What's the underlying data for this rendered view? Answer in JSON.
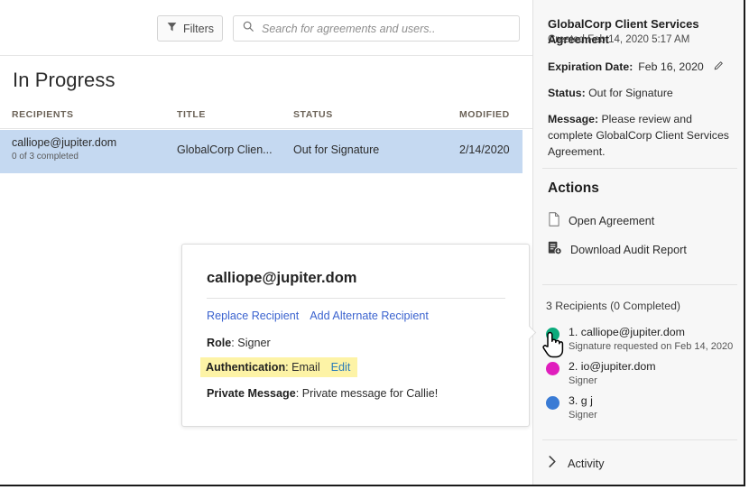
{
  "toolbar": {
    "filters_label": "Filters",
    "filter_icon": "funnel-icon",
    "search_icon": "search-icon",
    "search_value": "",
    "search_placeholder": "Search for agreements and users.."
  },
  "main": {
    "section_title": "In Progress",
    "columns": [
      "RECIPIENTS",
      "TITLE",
      "STATUS",
      "MODIFIED"
    ],
    "rows": [
      {
        "recipient": "calliope@jupiter.dom",
        "recipient_sub": "0 of 3 completed",
        "title": "GlobalCorp Clien...",
        "status": "Out for Signature",
        "modified": "2/14/2020",
        "selected_color": "#c5d9f1"
      }
    ]
  },
  "popup": {
    "title": "calliope@jupiter.dom",
    "links": [
      {
        "label": "Replace Recipient"
      },
      {
        "label": "Add Alternate Recipient"
      }
    ],
    "link_color": "#3b63cf",
    "fields": {
      "role_key": "Role",
      "role_value": "Signer",
      "auth_key": "Authentication",
      "auth_value": "Email",
      "auth_edit": "Edit",
      "auth_highlight_color": "#fdf3a6",
      "auth_edit_color": "#2b7cb8",
      "pm_key": "Private Message",
      "pm_value": "Private message for Callie!"
    }
  },
  "sidebar": {
    "agreement_title": "GlobalCorp Client Services Agreement",
    "created": "Created Feb 14, 2020 5:17 AM",
    "expiration_key": "Expiration Date:",
    "expiration_value": "Feb 16, 2020",
    "edit_icon": "pencil-icon",
    "status_key": "Status:",
    "status_value": "Out for Signature",
    "message_key": "Message:",
    "message_value": "Please review and complete GlobalCorp Client Services Agreement.",
    "actions_heading": "Actions",
    "actions": [
      {
        "label": "Open Agreement",
        "icon": "document-icon"
      },
      {
        "label": "Download Audit Report",
        "icon": "audit-report-icon"
      }
    ],
    "recipients_heading": "3 Recipients (0 Completed)",
    "recipients": [
      {
        "name": "1. calliope@jupiter.dom",
        "sub": "Signature requested on Feb 14, 2020",
        "color": "#0bab7c"
      },
      {
        "name": "2. io@jupiter.dom",
        "sub": "Signer",
        "color": "#e01ebd"
      },
      {
        "name": "3. g j",
        "sub": "Signer",
        "color": "#3a7bd5"
      }
    ],
    "activity_label": "Activity",
    "activity_icon": "chevron-right-icon"
  },
  "cursor": {
    "icon": "hand-pointer-cursor"
  }
}
